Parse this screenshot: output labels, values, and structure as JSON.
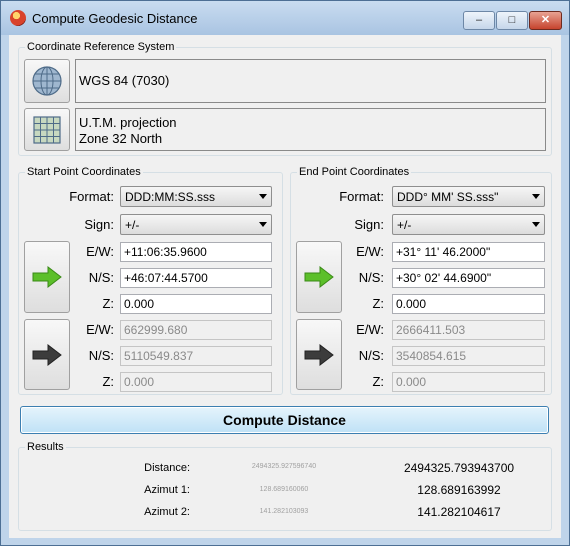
{
  "window": {
    "title": "Compute Geodesic Distance",
    "min_glyph": "–",
    "max_glyph": "□",
    "close_glyph": "✕"
  },
  "crs": {
    "legend": "Coordinate Reference System",
    "datum": "WGS 84 (7030)",
    "projection_line1": "U.T.M. projection",
    "projection_line2": "Zone 32 North",
    "datum_icon": "globe-icon",
    "projection_icon": "grid-map-icon"
  },
  "labels": {
    "format": "Format:",
    "sign": "Sign:",
    "ew": "E/W:",
    "ns": "N/S:",
    "z": "Z:"
  },
  "start": {
    "legend": "Start Point Coordinates",
    "format": "DDD:MM:SS.sss",
    "sign": "+/-",
    "ew": "+11:06:35.9600",
    "ns": "+46:07:44.5700",
    "z": "0.000",
    "proj_ew": "662999.680",
    "proj_ns": "5110549.837",
    "proj_z": "0.000"
  },
  "end": {
    "legend": "End Point Coordinates",
    "format": "DDD° MM' SS.sss\"",
    "sign": "+/-",
    "ew": "+31° 11' 46.2000\"",
    "ns": "+30° 02' 44.6900\"",
    "z": "0.000",
    "proj_ew": "2666411.503",
    "proj_ns": "3540854.615",
    "proj_z": "0.000"
  },
  "icons": {
    "down_arrow": "green-right-arrow-icon",
    "up_arrow": "gray-right-arrow-icon"
  },
  "colors": {
    "green_arrow": "#5cbf2a",
    "gray_arrow": "#3c3c3c",
    "accent": "#3c7fb1"
  },
  "compute_label": "Compute Distance",
  "results": {
    "legend": "Results",
    "distance_label": "Distance:",
    "azimuth1_label": "Azimut 1:",
    "azimuth2_label": "Azimut 2:",
    "distance_faint": "2494325.927596740",
    "azimuth1_faint": "128.689160060",
    "azimuth2_faint": "141.282103093",
    "distance": "2494325.793943700",
    "azimuth1": "128.689163992",
    "azimuth2": "141.282104617"
  }
}
